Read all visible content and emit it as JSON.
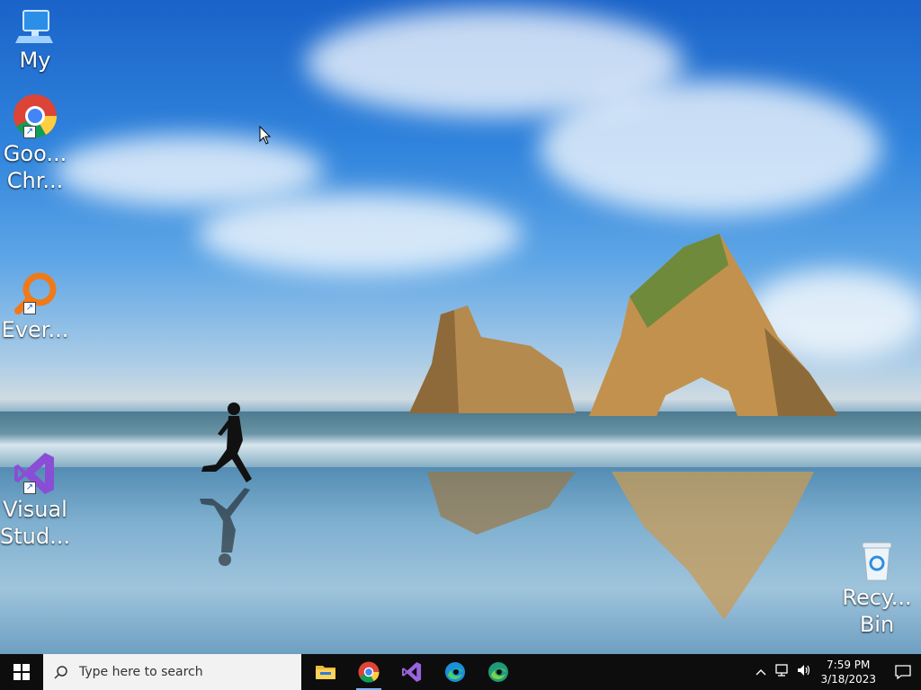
{
  "desktop": {
    "icons": [
      {
        "label": "My",
        "icon": "computer-icon"
      },
      {
        "label": "Goo... Chr...",
        "icon": "chrome-icon"
      },
      {
        "label": "Ever...",
        "icon": "everything-search-icon"
      },
      {
        "label": "Visual Stud...",
        "icon": "visual-studio-icon"
      },
      {
        "label": "Recy... Bin",
        "icon": "recycle-bin-icon"
      }
    ]
  },
  "taskbar": {
    "search_placeholder": "Type here to search",
    "apps": [
      {
        "name": "File Explorer",
        "icon": "folder-icon"
      },
      {
        "name": "Google Chrome",
        "icon": "chrome-icon",
        "active": true
      },
      {
        "name": "Visual Studio",
        "icon": "visual-studio-icon"
      },
      {
        "name": "Microsoft Edge",
        "icon": "edge-icon"
      },
      {
        "name": "Microsoft Edge Dev",
        "icon": "edge-dev-icon"
      }
    ],
    "clock": {
      "time": "7:59 PM",
      "date": "3/18/2023"
    }
  },
  "colors": {
    "taskbar": "#0d0d0d",
    "search_bg": "#f2f2f2",
    "accent": "#77b3ff"
  }
}
